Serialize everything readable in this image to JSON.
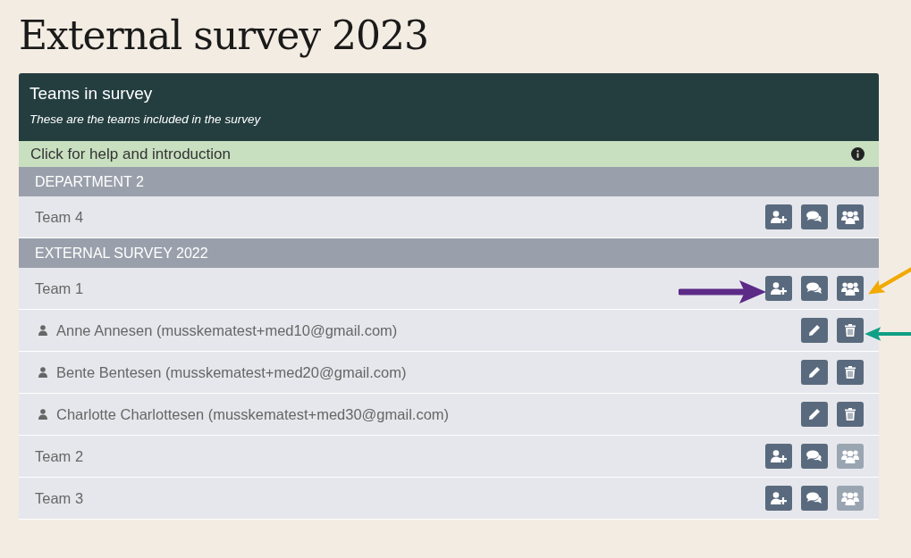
{
  "page_title": "External survey 2023",
  "panel": {
    "title": "Teams in survey",
    "subtitle": "These are the teams included in the survey",
    "help": "Click for help and introduction"
  },
  "rows": [
    {
      "kind": "group",
      "label": "DEPARTMENT 2"
    },
    {
      "kind": "team",
      "label": "Team 4",
      "actions": [
        {
          "kind": "add-member",
          "disabled": false
        },
        {
          "kind": "comments",
          "disabled": false
        },
        {
          "kind": "members",
          "disabled": false
        }
      ]
    },
    {
      "kind": "group",
      "label": "EXTERNAL SURVEY 2022"
    },
    {
      "kind": "team",
      "label": "Team 1",
      "actions": [
        {
          "kind": "add-member",
          "disabled": false
        },
        {
          "kind": "comments",
          "disabled": false
        },
        {
          "kind": "members",
          "disabled": false
        }
      ]
    },
    {
      "kind": "member",
      "label": "Anne Annesen (musskematest+med10@gmail.com)",
      "actions": [
        {
          "kind": "edit",
          "disabled": false
        },
        {
          "kind": "delete",
          "disabled": false
        }
      ]
    },
    {
      "kind": "member",
      "label": "Bente Bentesen (musskematest+med20@gmail.com)",
      "actions": [
        {
          "kind": "edit",
          "disabled": false
        },
        {
          "kind": "delete",
          "disabled": false
        }
      ]
    },
    {
      "kind": "member",
      "label": "Charlotte Charlottesen (musskematest+med30@gmail.com)",
      "actions": [
        {
          "kind": "edit",
          "disabled": false
        },
        {
          "kind": "delete",
          "disabled": false
        }
      ]
    },
    {
      "kind": "team",
      "label": "Team 2",
      "actions": [
        {
          "kind": "add-member",
          "disabled": false
        },
        {
          "kind": "comments",
          "disabled": false
        },
        {
          "kind": "members",
          "disabled": true
        }
      ]
    },
    {
      "kind": "team",
      "label": "Team 3",
      "actions": [
        {
          "kind": "add-member",
          "disabled": false
        },
        {
          "kind": "comments",
          "disabled": false
        },
        {
          "kind": "members",
          "disabled": true
        }
      ]
    }
  ],
  "annotations": [
    {
      "kind": "arrow-right",
      "color": "#5c2a87"
    },
    {
      "kind": "arrow-down-left",
      "color": "#f2a900"
    },
    {
      "kind": "arrow-left",
      "color": "#10a085"
    }
  ]
}
